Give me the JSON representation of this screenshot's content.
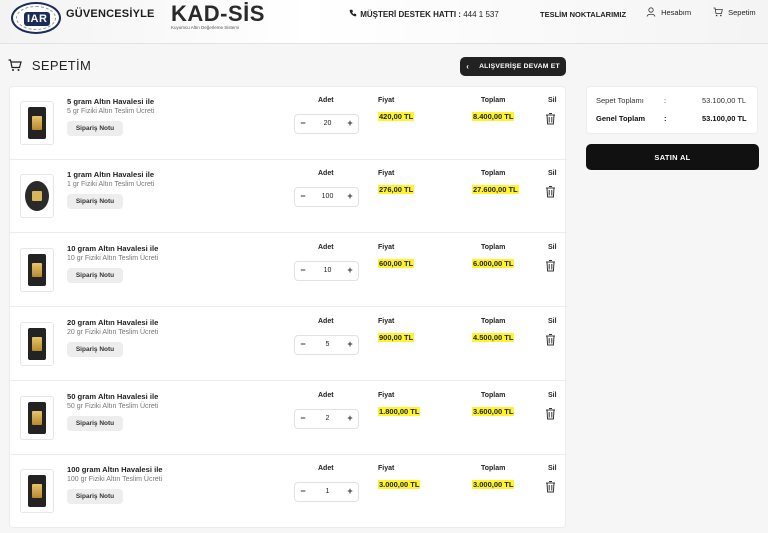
{
  "header": {
    "logo_badge": "IAR",
    "brand": "GÜVENCESİYLE",
    "product_title": "KAD-SİS",
    "product_subtitle": "Kuyumcu Altın Değerleme Sistemi",
    "support_label": "MÜŞTERİ DESTEK HATTI :",
    "support_number": "444 1 537",
    "nav_delivery": "TESLİM NOKTALARIMIZ",
    "nav_account": "Hesabım",
    "nav_cart": "Sepetim"
  },
  "page": {
    "title": "SEPETİM",
    "continue_shopping": "ALIŞVERİŞE DEVAM ET"
  },
  "columns": {
    "qty": "Adet",
    "price": "Fiyat",
    "total": "Toplam",
    "delete": "Sil"
  },
  "items": [
    {
      "title": "5 gram Altın Havalesi ile",
      "subtitle": "5 gr Fiziki Altın Teslim Ücreti",
      "note": "Sipariş Notu",
      "qty": "20",
      "price": "420,00 TL",
      "total": "8.400,00 TL",
      "image": "gold-bar"
    },
    {
      "title": "1 gram Altın Havalesi ile",
      "subtitle": "1 gr Fiziki Altın Teslim Ücreti",
      "note": "Sipariş Notu",
      "qty": "100",
      "price": "276,00 TL",
      "total": "27.600,00 TL",
      "image": "gold-bar-round"
    },
    {
      "title": "10 gram Altın Havalesi ile",
      "subtitle": "10 gr Fiziki Altın Teslim Ücreti",
      "note": "Sipariş Notu",
      "qty": "10",
      "price": "600,00 TL",
      "total": "6.000,00 TL",
      "image": "gold-bar"
    },
    {
      "title": "20 gram Altın Havalesi ile",
      "subtitle": "20 gr Fiziki Altın Teslim Ücreti",
      "note": "Sipariş Notu",
      "qty": "5",
      "price": "900,00 TL",
      "total": "4.500,00 TL",
      "image": "gold-bar"
    },
    {
      "title": "50 gram Altın Havalesi ile",
      "subtitle": "50 gr Fiziki Altın Teslim Ücreti",
      "note": "Sipariş Notu",
      "qty": "2",
      "price": "1.800,00 TL",
      "total": "3.600,00 TL",
      "image": "gold-bar"
    },
    {
      "title": "100 gram Altın Havalesi ile",
      "subtitle": "100 gr Fiziki Altın Teslim Ücreti",
      "note": "Sipariş Notu",
      "qty": "1",
      "price": "3.000,00 TL",
      "total": "3.000,00 TL",
      "image": "gold-bar"
    }
  ],
  "stepper": {
    "minus": "−",
    "plus": "+"
  },
  "summary": {
    "subtotal_label": "Sepet Toplamı",
    "subtotal_value": "53.100,00 TL",
    "grand_label": "Genel Toplam",
    "grand_value": "53.100,00 TL",
    "separator": ":"
  },
  "buy_button": "SATIN AL",
  "colors": {
    "highlight": "#fff42a",
    "dark_button": "#111111",
    "logo_navy": "#1d2b5a"
  },
  "icons": [
    "phone-icon",
    "user-icon",
    "cart-icon",
    "chevron-left-icon",
    "trash-icon"
  ]
}
